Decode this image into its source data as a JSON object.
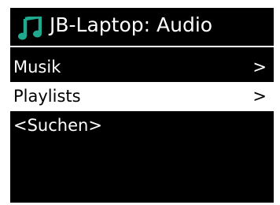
{
  "header": {
    "icon": "music-note-icon",
    "title": "JB-Laptop: Audio"
  },
  "menu": {
    "items": [
      {
        "label": "Musik",
        "arrow": ">",
        "selected": false
      },
      {
        "label": "Playlists",
        "arrow": ">",
        "selected": true
      },
      {
        "label": "<Suchen>",
        "arrow": "",
        "selected": false
      }
    ]
  },
  "colors": {
    "screen_background": "#000000",
    "text": "#ffffff",
    "icon": "#1fa98f",
    "selection_background": "#ffffff",
    "selection_text": "#000000"
  }
}
